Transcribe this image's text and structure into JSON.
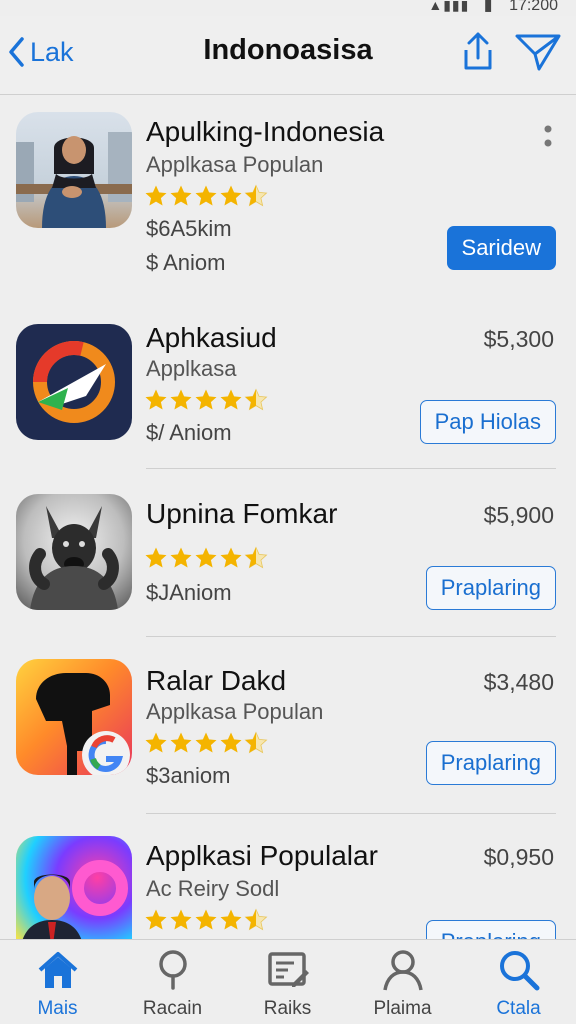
{
  "status_bar": {
    "time": "17:200"
  },
  "navbar": {
    "back_label": "Lak",
    "title": "Indonoasisa"
  },
  "apps": [
    {
      "name": "Apulking-Indonesia",
      "subtitle": "Applkasa Populan",
      "rating": 4.5,
      "meta1": "$6A5kim",
      "meta2": "$  Aniom",
      "button": "Saridew"
    },
    {
      "name": "Aphkasiud",
      "subtitle": "Applkasa",
      "rating": 4.5,
      "meta1": "$/ Aniom",
      "price": "$5,300",
      "button": "Pap Hiolas"
    },
    {
      "name": "Upnina Fomkar",
      "rating": 4.5,
      "meta1": "$JAniom",
      "price": "$5,900",
      "button": "Praplaring"
    },
    {
      "name": "Ralar Dakd",
      "subtitle": "Applkasa Populan",
      "rating": 4.5,
      "meta1": "$3aniom",
      "price": "$3,480",
      "button": "Praplaring"
    },
    {
      "name": "Applkasi Populalar",
      "subtitle": "Ac Reiry Sodl",
      "rating": 4.5,
      "price": "$0,950",
      "button": "Praplaring"
    }
  ],
  "tabs": [
    {
      "label": "Mais",
      "icon": "home-icon",
      "active": true
    },
    {
      "label": "Racain",
      "icon": "location-pin-icon"
    },
    {
      "label": "Raiks",
      "icon": "document-edit-icon"
    },
    {
      "label": "Plaima",
      "icon": "person-icon"
    },
    {
      "label": "Ctala",
      "icon": "search-icon",
      "active": true
    }
  ],
  "colors": {
    "accent": "#1a73d9",
    "star": "#f4b400",
    "background": "#eeeeee"
  }
}
